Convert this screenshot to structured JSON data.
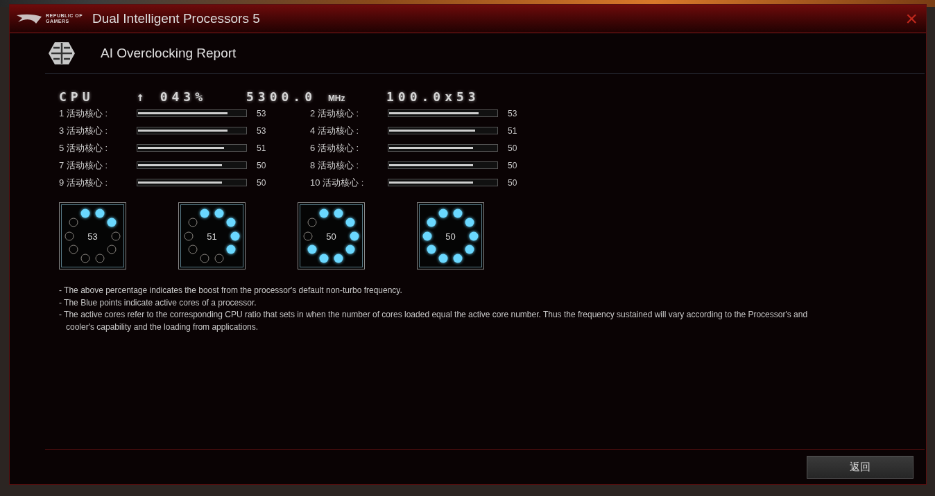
{
  "window": {
    "title": "Dual Intelligent Processors 5",
    "logo_text": [
      "REPUBLIC OF",
      "GAMERS"
    ],
    "close": "×"
  },
  "header": {
    "title": "AI Overclocking Report"
  },
  "summary": {
    "label": "CPU",
    "boost_arrow": "↑",
    "boost": "043%",
    "frequency": "5300.0",
    "frequency_unit": "MHz",
    "ratio": "100.0x53"
  },
  "cores": [
    {
      "label": "1 活动核心 :",
      "level": 0.83,
      "value": "53"
    },
    {
      "label": "2 活动核心 :",
      "level": 0.83,
      "value": "53"
    },
    {
      "label": "3 活动核心 :",
      "level": 0.83,
      "value": "53"
    },
    {
      "label": "4 活动核心 :",
      "level": 0.8,
      "value": "51"
    },
    {
      "label": "5 活动核心 :",
      "level": 0.8,
      "value": "51"
    },
    {
      "label": "6 活动核心 :",
      "level": 0.78,
      "value": "50"
    },
    {
      "label": "7 活动核心 :",
      "level": 0.78,
      "value": "50"
    },
    {
      "label": "8 活动核心 :",
      "level": 0.78,
      "value": "50"
    },
    {
      "label": "9 活动核心 :",
      "level": 0.78,
      "value": "50"
    },
    {
      "label": "10 活动核心 :",
      "level": 0.78,
      "value": "50"
    }
  ],
  "dials": [
    {
      "value": "53",
      "dots": [
        true,
        true,
        true,
        false,
        false,
        false,
        false,
        false,
        false,
        false
      ]
    },
    {
      "value": "51",
      "dots": [
        true,
        true,
        true,
        true,
        true,
        false,
        false,
        false,
        false,
        false
      ]
    },
    {
      "value": "50",
      "dots": [
        true,
        true,
        true,
        true,
        true,
        true,
        true,
        true,
        false,
        false
      ]
    },
    {
      "value": "50",
      "dots": [
        true,
        true,
        true,
        true,
        true,
        true,
        true,
        true,
        true,
        true
      ]
    }
  ],
  "notes": [
    "- The above percentage indicates the boost from the processor's default non-turbo frequency.",
    "- The Blue points indicate active cores of a processor.",
    "- The active cores refer to the corresponding CPU ratio that sets in when the number of cores loaded equal the active core  number. Thus the frequency sustained will vary according to the Processor's and cooler's capability and the loading from applications."
  ],
  "buttons": [
    "返回"
  ]
}
